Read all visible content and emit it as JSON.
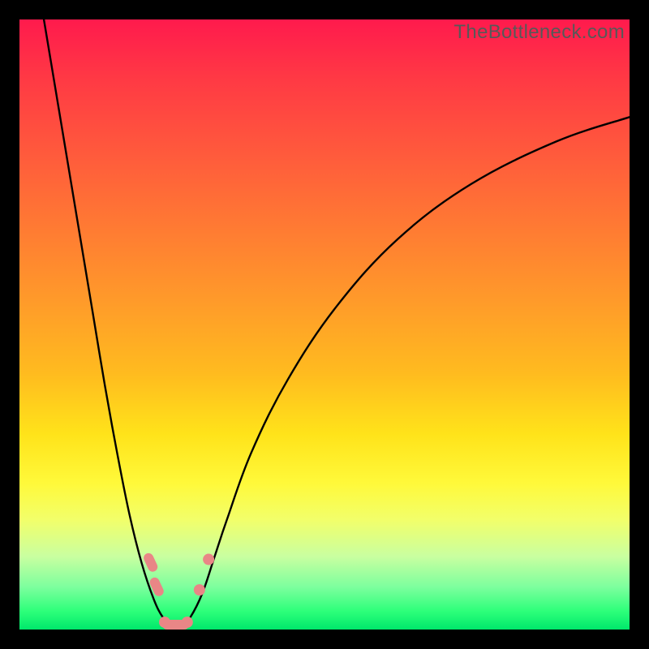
{
  "watermark": "TheBottleneck.com",
  "colors": {
    "gradient_top": "#ff1a4d",
    "gradient_bottom": "#00e86b",
    "curve": "#000000",
    "marker": "#e98686",
    "frame": "#000000"
  },
  "chart_data": {
    "type": "line",
    "title": "",
    "xlabel": "",
    "ylabel": "",
    "xlim": [
      0,
      100
    ],
    "ylim": [
      0,
      100
    ],
    "grid": false,
    "legend": false,
    "series": [
      {
        "name": "bottleneck-curve",
        "x": [
          4,
          6,
          8,
          10,
          12,
          14,
          16,
          18,
          20,
          22,
          23.5,
          25,
          26.5,
          28,
          30,
          32,
          34,
          38,
          44,
          52,
          62,
          74,
          88,
          100
        ],
        "y": [
          100,
          88,
          76,
          64,
          52,
          40,
          29,
          19,
          11,
          5,
          2,
          0.5,
          0.5,
          2,
          6,
          12,
          18,
          29,
          41,
          53,
          64,
          73,
          80,
          84
        ]
      }
    ],
    "markers": [
      {
        "x": 21.5,
        "y": 11,
        "shape": "capsule",
        "angle": 65
      },
      {
        "x": 22.5,
        "y": 7,
        "shape": "capsule",
        "angle": 65
      },
      {
        "x": 23.8,
        "y": 1.2,
        "shape": "circle"
      },
      {
        "x": 25.0,
        "y": 0.8,
        "shape": "capsule",
        "angle": 0
      },
      {
        "x": 26.2,
        "y": 0.8,
        "shape": "capsule",
        "angle": 0
      },
      {
        "x": 27.5,
        "y": 1.2,
        "shape": "circle"
      },
      {
        "x": 29.5,
        "y": 6.5,
        "shape": "circle"
      },
      {
        "x": 31.0,
        "y": 11.5,
        "shape": "circle"
      }
    ]
  }
}
